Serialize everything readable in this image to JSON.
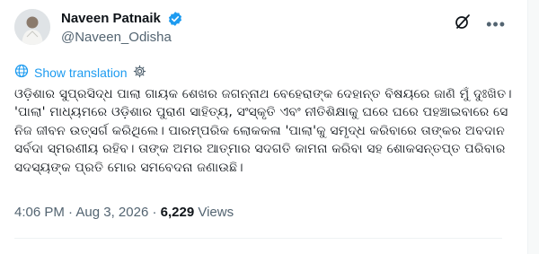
{
  "tweet": {
    "author": {
      "name": "Naveen Patnaik",
      "handle": "@Naveen_Odisha",
      "verified": true
    },
    "translate": {
      "label": "Show translation"
    },
    "text": "ଓଡ଼ିଶାର ସୁପ୍ରସିଦ୍ଧ ପାଲା ଗାୟକ ଶେଖର ଜଗନ୍ନାଥ ବେହେରାଙ୍କ ଦେହାନ୍ତ ବିଷୟରେ ଜାଣି ମୁଁ ଦୁଃଖିତ। 'ପାଲା' ମାଧ୍ୟମରେ ଓଡ଼ିଶାର ପୁରାଣ ସାହିତ୍ୟ, ସଂସ୍କୃତି ଏବଂ ନୀତିଶିକ୍ଷାକୁ ଘରେ ଘରେ ପହଞ୍ଚାଇବାରେ ସେ ନିଜ ଜୀବନ ଉତ୍ସର୍ଗ କରିଥିଲେ। ପାରମ୍ପରିକ ଲୋକକଳା 'ପାଲା'କୁ ସମୃଦ୍ଧ କରିବାରେ ତାଙ୍କର ଅବଦାନ ସର୍ବଦା ସ୍ମରଣୀୟ ରହିବ। ତାଙ୍କ ଅମର ଆତ୍ମାର ସଦଗତି କାମନା କରିବା ସହ ଶୋକସନ୍ତପ୍ତ ପରିବାର ସଦସ୍ୟଙ୍କ ପ୍ରତି ମୋର ସମବେଦନା ଜଣାଉଛି।",
    "meta": {
      "time": "4:06 PM",
      "separator": "·",
      "date": "Aug 3, 2026",
      "views_count": "6,229",
      "views_label": "Views"
    }
  },
  "colors": {
    "accent": "#1d9bf0",
    "secondary_text": "#536471",
    "primary_text": "#0f1419"
  },
  "icons": {
    "verified": "verified-badge-icon",
    "grok": "grok-icon",
    "more": "more-icon",
    "translate": "globe-icon",
    "settings": "gear-icon"
  }
}
